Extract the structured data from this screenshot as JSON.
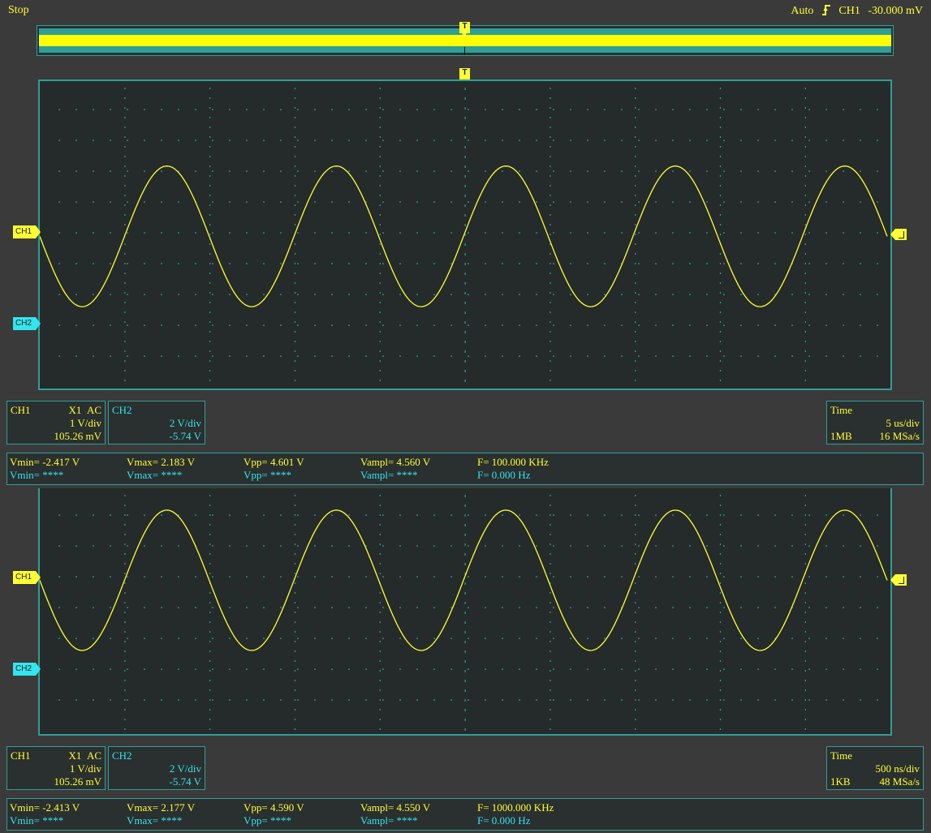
{
  "status": "Stop",
  "trigger": {
    "mode": "Auto",
    "icon": "rising-edge-icon",
    "source": "CH1",
    "level": "-30.000 mV"
  },
  "markers": {
    "trigger": "T",
    "ch1": "CH1",
    "ch2": "CH2"
  },
  "colors": {
    "ch1": "#ffff33",
    "ch2": "#33e5ee",
    "grid": "#2f9f97",
    "bg": "#252b2a"
  },
  "panels": [
    {
      "waveform": {
        "cycles": 5,
        "phase_deg": 180,
        "vmax": 2.183,
        "vmin": -2.417
      },
      "ch1_box": {
        "name": "CH1",
        "probe": "X1",
        "coupling": "AC",
        "scale": "1 V/div",
        "offset": "105.26 mV"
      },
      "ch2_box": {
        "name": "CH2",
        "scale": "2 V/div",
        "offset": "-5.74 V"
      },
      "time_box": {
        "label": "Time",
        "scale": "5 us/div",
        "mem": "1MB",
        "rate": "16 MSa/s"
      },
      "meas": {
        "ch1": {
          "vmin": "Vmin= -2.417 V",
          "vmax": "Vmax= 2.183 V",
          "vpp": "Vpp= 4.601 V",
          "vampl": "Vampl= 4.560 V",
          "freq": "F= 100.000 KHz"
        },
        "ch2": {
          "vmin": "Vmin= ****",
          "vmax": "Vmax= ****",
          "vpp": "Vpp= ****",
          "vampl": "Vampl= ****",
          "freq": "F= 0.000 Hz"
        }
      }
    },
    {
      "waveform": {
        "cycles": 5,
        "phase_deg": 180,
        "vmax": 2.177,
        "vmin": -2.413
      },
      "ch1_box": {
        "name": "CH1",
        "probe": "X1",
        "coupling": "AC",
        "scale": "1 V/div",
        "offset": "105.26 mV"
      },
      "ch2_box": {
        "name": "CH2",
        "scale": "2 V/div",
        "offset": "-5.74 V"
      },
      "time_box": {
        "label": "Time",
        "scale": "500 ns/div",
        "mem": "1KB",
        "rate": "48 MSa/s"
      },
      "meas": {
        "ch1": {
          "vmin": "Vmin= -2.413 V",
          "vmax": "Vmax= 2.177 V",
          "vpp": "Vpp= 4.590 V",
          "vampl": "Vampl= 4.550 V",
          "freq": "F= 1000.000 KHz"
        },
        "ch2": {
          "vmin": "Vmin= ****",
          "vmax": "Vmax= ****",
          "vpp": "Vpp= ****",
          "vampl": "Vampl= ****",
          "freq": "F= 0.000 Hz"
        }
      }
    }
  ]
}
